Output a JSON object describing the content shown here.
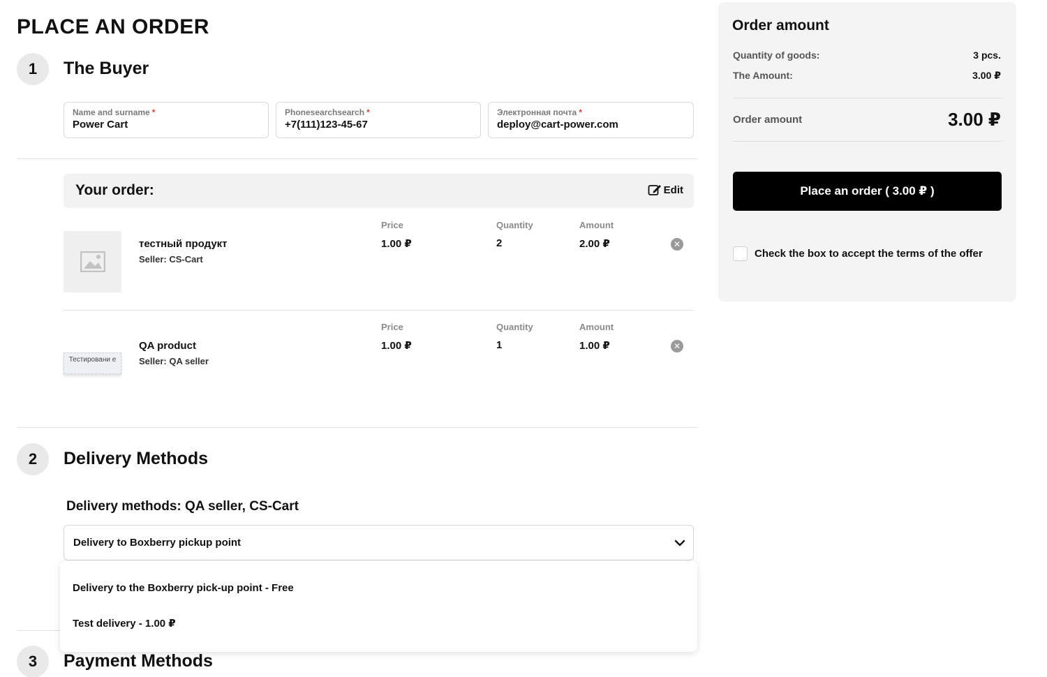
{
  "page": {
    "title": "PLACE AN ORDER"
  },
  "steps": {
    "buyer": {
      "num": "1",
      "title": "The Buyer"
    },
    "delivery": {
      "num": "2",
      "title": "Delivery Methods"
    },
    "payment": {
      "num": "3",
      "title": "Payment Methods"
    }
  },
  "buyer_fields": {
    "name": {
      "label": "Name and surname",
      "req": "*",
      "value": "Power Cart"
    },
    "phone": {
      "label": "Phonesearchsearch",
      "req": "*",
      "value": "+7(111)123-45-67"
    },
    "email": {
      "label": "Электронная почта",
      "req": "*",
      "value": "deploy@cart-power.com"
    }
  },
  "order": {
    "heading": "Your order:",
    "edit_label": "Edit",
    "col_price": "Price",
    "col_quantity": "Quantity",
    "col_amount": "Amount",
    "items": [
      {
        "name": "тестный продукт",
        "seller": "Seller:  CS-Cart",
        "price": "1.00 ₽",
        "quantity": "2",
        "amount": "2.00 ₽",
        "thumb_icon": "image-placeholder-icon"
      },
      {
        "name": "QA product",
        "seller": "Seller: QA seller",
        "price": "1.00 ₽",
        "quantity": "1",
        "amount": "1.00 ₽",
        "thumb_text": "Тестировани е"
      }
    ]
  },
  "delivery": {
    "heading": "Delivery methods: QA seller, CS-Cart",
    "selected": "Delivery to Boxberry pickup point",
    "options": [
      "Delivery to the Boxberry pick-up point - Free",
      "Test delivery - 1.00 ₽"
    ]
  },
  "summary": {
    "title": "Order amount",
    "qty_label": "Quantity of goods:",
    "qty_value": "3 pcs.",
    "amount_label": "The Amount:",
    "amount_value": "3.00 ₽",
    "total_label": "Order amount",
    "total_value": "3.00 ₽",
    "button_label": "Place an order ( 3.00 ₽ )",
    "terms_label": "Check the box to accept the terms of the offer"
  },
  "colors": {
    "accent": "#000000",
    "required": "#e03a3a",
    "panel": "#f4f4f4"
  }
}
